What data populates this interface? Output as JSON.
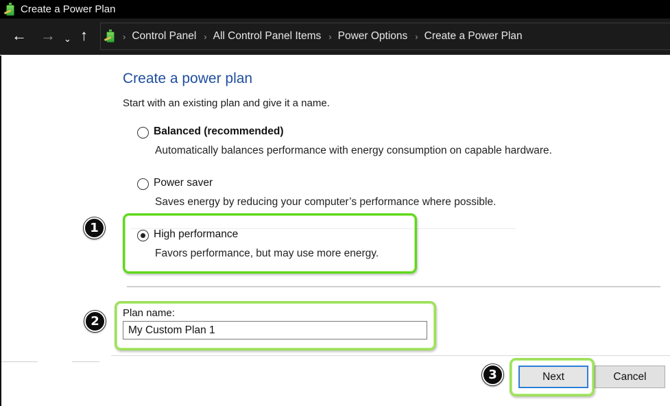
{
  "window": {
    "title": "Create a Power Plan",
    "app_icon": "power-options-battery-icon"
  },
  "navigation": {
    "back_icon": "←",
    "forward_icon": "→",
    "recent_icon": "⌄",
    "up_icon": "↑",
    "separator": "›",
    "breadcrumbs": [
      {
        "label": "Control Panel"
      },
      {
        "label": "All Control Panel Items"
      },
      {
        "label": "Power Options"
      },
      {
        "label": "Create a Power Plan"
      }
    ]
  },
  "page": {
    "heading": "Create a power plan",
    "subheading": "Start with an existing plan and give it a name.",
    "plans": [
      {
        "label": "Balanced (recommended)",
        "description": "Automatically balances performance with energy consumption on capable hardware.",
        "selected": false,
        "bold": true
      },
      {
        "label": "Power saver",
        "description": "Saves energy by reducing your computer’s performance where possible.",
        "selected": false,
        "bold": false
      },
      {
        "label": "High performance",
        "description": "Favors performance, but may use more energy.",
        "selected": true,
        "bold": false
      }
    ],
    "plan_name": {
      "label": "Plan name:",
      "value": "My Custom Plan 1"
    },
    "buttons": {
      "next": "Next",
      "cancel": "Cancel"
    }
  },
  "annotations": {
    "badges": [
      "1",
      "2",
      "3"
    ],
    "highlight_color": "#7bd83a"
  },
  "colors": {
    "heading": "#1e4e9c",
    "titlebar": "#000000",
    "navbar": "#1b1b1b",
    "focus_border": "#2b7fd8"
  }
}
